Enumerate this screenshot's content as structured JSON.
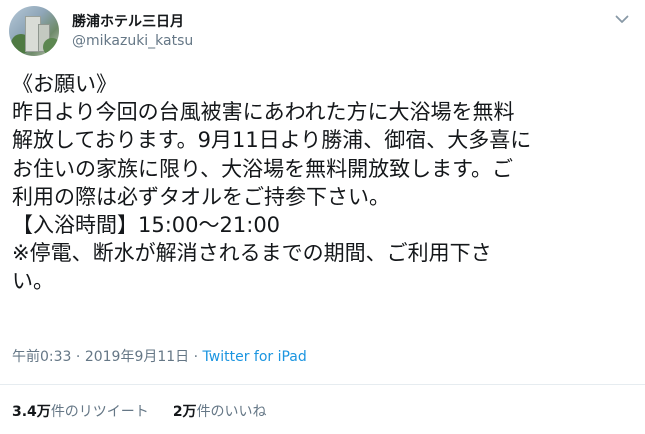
{
  "user": {
    "display_name": "勝浦ホテル三日月",
    "handle": "@mikazuki_katsu"
  },
  "tweet": {
    "lines": [
      "《お願い》",
      "昨日より今回の台風被害にあわれた方に大浴場を無料",
      "解放しております。9月11日より勝浦、御宿、大多喜に",
      "お住いの家族に限り、大浴場を無料開放致します。ご",
      "利用の際は必ずタオルをご持参下さい。",
      "【入浴時間】15:00〜21:00",
      "※停電、断水が解消されるまでの期間、ご利用下さ",
      "い。"
    ]
  },
  "meta": {
    "time": "午前0:33",
    "dot1": "·",
    "date": "2019年9月11日",
    "dot2": "·",
    "source": "Twitter for iPad"
  },
  "stats": {
    "retweets_count": "3.4万",
    "retweets_label": "件のリツイート",
    "likes_count": "2万",
    "likes_label": "件のいいね"
  },
  "icons": {
    "menu": "chevron-down-icon",
    "avatar": "hotel-building-photo"
  },
  "colors": {
    "text": "#14171a",
    "secondary": "#657786",
    "link": "#1b95e0",
    "divider": "#e6ecf0"
  }
}
